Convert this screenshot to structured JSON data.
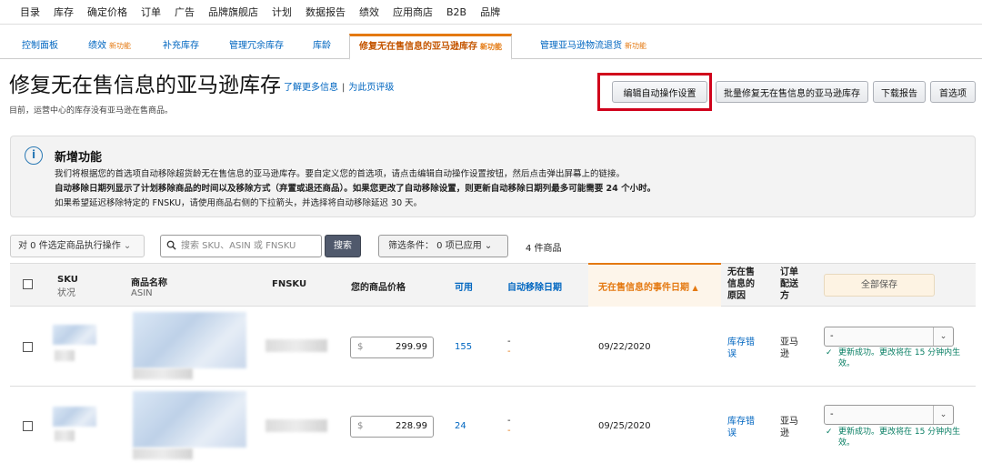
{
  "top_nav": [
    "目录",
    "库存",
    "确定价格",
    "订单",
    "广告",
    "品牌旗舰店",
    "计划",
    "数据报告",
    "绩效",
    "应用商店",
    "B2B",
    "品牌"
  ],
  "sub_tabs": [
    {
      "label": "控制面板",
      "badge": ""
    },
    {
      "label": "绩效",
      "badge": "新功能"
    },
    {
      "label": "补充库存",
      "badge": ""
    },
    {
      "label": "管理冗余库存",
      "badge": ""
    },
    {
      "label": "库龄",
      "badge": ""
    },
    {
      "label": "修复无在售信息的亚马逊库存",
      "badge": "新功能"
    },
    {
      "label": "管理亚马逊物流退货",
      "badge": "新功能"
    }
  ],
  "page": {
    "title": "修复无在售信息的亚马逊库存",
    "learn_more": "了解更多信息",
    "separator": "|",
    "rate_page": "为此页评级",
    "subtitle": "目前，运营中心的库存没有亚马逊在售商品。"
  },
  "buttons": {
    "edit_auto": "编辑自动操作设置",
    "bulk_fix": "批量修复无在售信息的亚马逊库存",
    "download": "下载报告",
    "preferences": "首选项"
  },
  "notice": {
    "icon": "info-icon",
    "title": "新增功能",
    "line1": "我们将根据您的首选项自动移除超货龄无在售信息的亚马逊库存。要自定义您的首选项，请点击编辑自动操作设置按钮，然后点击弹出屏幕上的链接。",
    "line2": "自动移除日期列显示了计划移除商品的时间以及移除方式（弃置或退还商品）。如果您更改了自动移除设置，则更新自动移除日期列最多可能需要 24 个小时。",
    "line3": "如果希望延迟移除特定的 FNSKU，请使用商品右侧的下拉箭头，并选择将自动移除延迟 30 天。"
  },
  "toolbar": {
    "bulk_action": "对 0 件选定商品执行操作",
    "search_placeholder": "搜索 SKU、ASIN 或 FNSKU",
    "search_button": "搜索",
    "filter": "筛选条件： 0 项已应用",
    "count": "4 件商品"
  },
  "table": {
    "headers": {
      "sku": "SKU",
      "status": "状况",
      "product_name": "商品名称",
      "asin": "ASIN",
      "fnsku": "FNSKU",
      "price": "您的商品价格",
      "available": "可用",
      "auto_removal_date": "自动移除日期",
      "event_date": "无在售信息的事件日期",
      "reason": "无在售信息的原因",
      "fulfillment": "订单配送方",
      "save_all": "全部保存"
    },
    "rows": [
      {
        "currency": "$",
        "price": "299.99",
        "available": "155",
        "auto_removal": "-",
        "auto_removal_2": "-",
        "event_date": "09/22/2020",
        "reason": "库存错误",
        "fulfillment": "亚马逊",
        "action": "-",
        "success": "更新成功。更改将在 15 分钟内生效。"
      },
      {
        "currency": "$",
        "price": "228.99",
        "available": "24",
        "auto_removal": "-",
        "auto_removal_2": "-",
        "event_date": "09/25/2020",
        "reason": "库存错误",
        "fulfillment": "亚马逊",
        "action": "-",
        "success": "更新成功。更改将在 15 分钟内生效。"
      }
    ]
  },
  "colors": {
    "link": "#0066c0",
    "accent": "#e47911",
    "highlight": "#d0021b",
    "success": "#067d62"
  }
}
